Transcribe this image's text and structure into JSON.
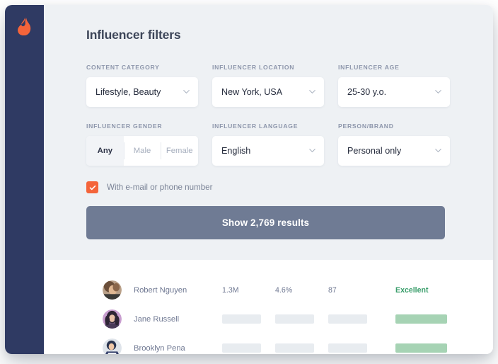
{
  "brand": {
    "logo_icon": "flame-icon",
    "logo_color": "#f4643a",
    "sidebar_color": "#2f3a63"
  },
  "panel": {
    "title": "Influencer filters",
    "accent_color": "#f4643a",
    "cta_color": "#6f7b94"
  },
  "filters": {
    "content_category": {
      "label": "CONTENT CATEGORY",
      "value": "Lifestyle, Beauty",
      "type": "select"
    },
    "influencer_location": {
      "label": "INFLUENCER LOCATION",
      "value": "New York, USA",
      "type": "select"
    },
    "influencer_age": {
      "label": "INFLUENCER AGE",
      "value": "25-30 y.o.",
      "type": "select"
    },
    "influencer_gender": {
      "label": "INFLUENCER GENDER",
      "type": "segmented",
      "options": [
        "Any",
        "Male",
        "Female"
      ],
      "selected": "Any"
    },
    "influencer_language": {
      "label": "INFLUENCER LANGUAGE",
      "value": "English",
      "type": "select"
    },
    "person_brand": {
      "label": "PERSON/BRAND",
      "value": "Personal only",
      "type": "select"
    },
    "contact_checkbox": {
      "label": "With e-mail or phone number",
      "checked": true
    }
  },
  "cta": {
    "label": "Show 2,769 results",
    "count": "2,769"
  },
  "results": {
    "rows": [
      {
        "name": "Robert Nguyen",
        "followers": "1.3M",
        "engagement": "4.6%",
        "score": "87",
        "rating": "Excellent",
        "rating_color": "#3a9e6b",
        "loaded": true
      },
      {
        "name": "Jane Russell",
        "followers": "",
        "engagement": "",
        "score": "",
        "rating": "",
        "loaded": false
      },
      {
        "name": "Brooklyn Pena",
        "followers": "",
        "engagement": "",
        "score": "",
        "rating": "",
        "loaded": false
      }
    ]
  }
}
